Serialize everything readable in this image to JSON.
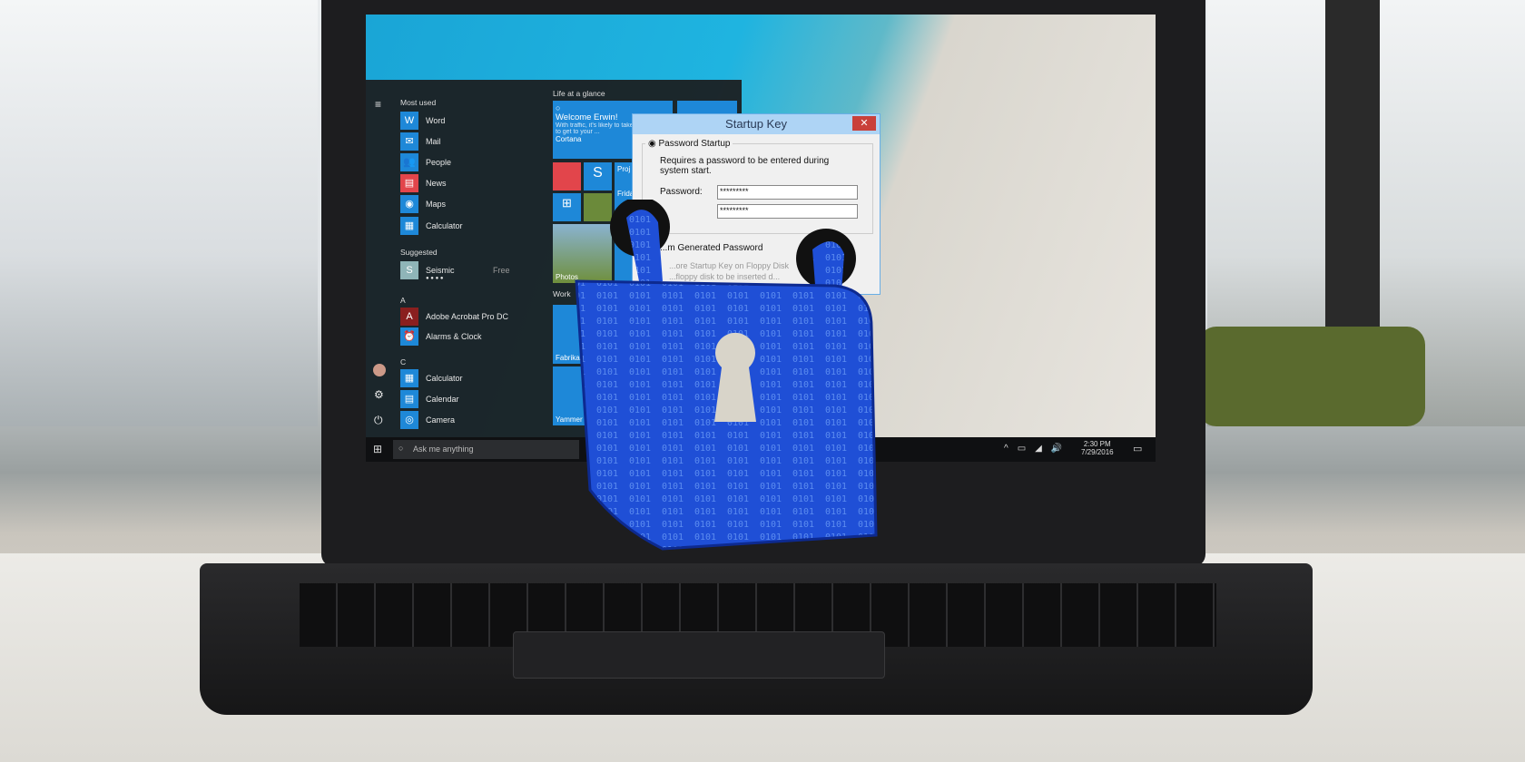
{
  "start_menu": {
    "most_used_header": "Most used",
    "most_used": [
      {
        "label": "Word",
        "icon": "word-icon"
      },
      {
        "label": "Mail",
        "icon": "mail-icon"
      },
      {
        "label": "People",
        "icon": "people-icon"
      },
      {
        "label": "News",
        "icon": "news-icon"
      },
      {
        "label": "Maps",
        "icon": "maps-icon"
      },
      {
        "label": "Calculator",
        "icon": "calculator-icon"
      }
    ],
    "suggested_header": "Suggested",
    "suggested": {
      "label": "Seismic",
      "price": "Free",
      "rating": 4
    },
    "section_a": "A",
    "a_apps": [
      {
        "label": "Adobe Acrobat Pro DC"
      },
      {
        "label": "Alarms & Clock"
      }
    ],
    "section_c": "C",
    "c_apps": [
      {
        "label": "Calculator"
      },
      {
        "label": "Calendar"
      },
      {
        "label": "Camera"
      }
    ],
    "life_header": "Life at a glance",
    "cortana": {
      "title": "Welcome Erwin!",
      "text": "With traffic, it's likely to take ... minutes to get to your ...",
      "label": "Cortana"
    },
    "project_tile": "Proj",
    "friday_tile": "Frida",
    "photos_tile": "Photos",
    "work_header": "Work",
    "fabrikam_tile": "Fabrikam",
    "yammer_tile": "Yammer"
  },
  "taskbar": {
    "search_placeholder": "Ask me anything",
    "time": "2:30 PM",
    "date": "7/29/2016"
  },
  "dialog": {
    "title": "Startup Key",
    "option1": "Password Startup",
    "option1_desc": "Requires a password to be entered during system start.",
    "password_label": "Password:",
    "password_value": "*********",
    "confirm_value": "*********",
    "option2": "...m Generated Password",
    "option2_sub": "...ore Startup Key on Floppy Disk",
    "option2_desc": "...floppy disk to be inserted d..."
  },
  "colors": {
    "accent": "#1e88d8",
    "lock": "#1f4fd6"
  }
}
